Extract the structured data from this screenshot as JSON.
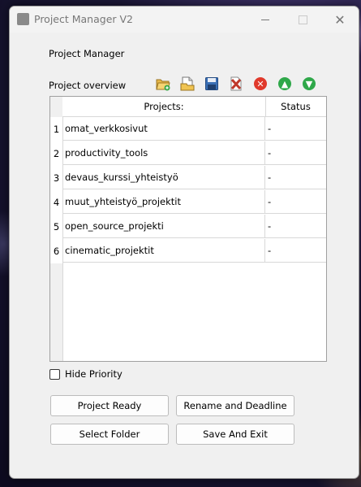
{
  "window": {
    "title": "Project Manager V2",
    "controls": {
      "minimize": "—",
      "maximize": "☐",
      "close": "✕"
    }
  },
  "main": {
    "header_label": "Project Manager",
    "overview_label": "Project overview"
  },
  "toolbar": {
    "icons": [
      "open-folder-icon",
      "new-file-icon",
      "save-icon",
      "delete-icon",
      "cancel-icon",
      "move-up-icon",
      "move-down-icon"
    ],
    "colors": {
      "cancel": "#e0392b",
      "up": "#2fa84a",
      "down": "#2fa84a",
      "delete": "#c0392b",
      "save": "#3a6fb5"
    }
  },
  "table": {
    "columns": [
      "Projects:",
      "Status"
    ],
    "rows": [
      {
        "num": "1",
        "project": "omat_verkkosivut",
        "status": "-"
      },
      {
        "num": "2",
        "project": "productivity_tools",
        "status": "-"
      },
      {
        "num": "3",
        "project": "devaus_kurssi_yhteistyö",
        "status": "-"
      },
      {
        "num": "4",
        "project": "muut_yhteistyö_projektit",
        "status": "-"
      },
      {
        "num": "5",
        "project": "open_source_projekti",
        "status": "-"
      },
      {
        "num": "6",
        "project": "cinematic_projektit",
        "status": "-"
      }
    ]
  },
  "options": {
    "hide_priority_label": "Hide Priority",
    "hide_priority_checked": false
  },
  "buttons": {
    "project_ready": "Project Ready",
    "rename_deadline": "Rename and Deadline",
    "select_folder": "Select Folder",
    "save_exit": "Save And Exit"
  }
}
